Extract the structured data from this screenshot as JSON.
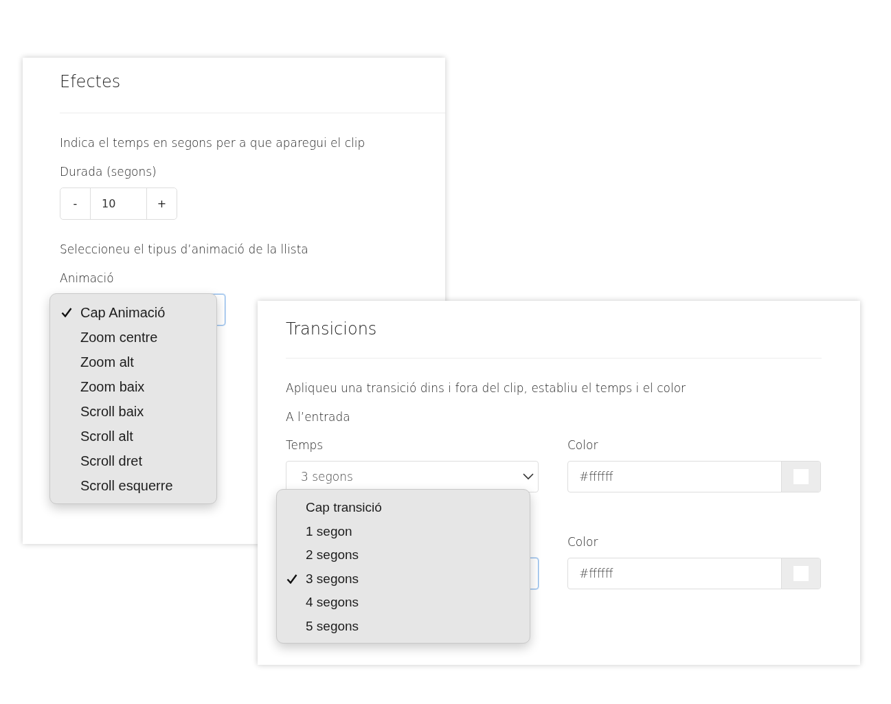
{
  "effects_panel": {
    "title": "Efectes",
    "duration_hint": "Indica el temps en segons per a que aparegui el clip",
    "duration_label": "Durada (segons)",
    "stepper": {
      "decrement": "-",
      "value": "10",
      "increment": "+"
    },
    "animation_hint": "Seleccioneu el tipus d’animació de la llista",
    "animation_label": "Animació",
    "animation_menu": [
      {
        "label": "Cap Animació",
        "selected": true
      },
      {
        "label": "Zoom centre",
        "selected": false
      },
      {
        "label": "Zoom alt",
        "selected": false
      },
      {
        "label": "Zoom baix",
        "selected": false
      },
      {
        "label": "Scroll baix",
        "selected": false
      },
      {
        "label": "Scroll alt",
        "selected": false
      },
      {
        "label": "Scroll dret",
        "selected": false
      },
      {
        "label": "Scroll esquerre",
        "selected": false
      }
    ]
  },
  "transitions_panel": {
    "title": "Transicions",
    "hint": "Apliqueu una transició dins i fora del clip, establiu el temps i el color",
    "entry_label": "A l’entrada",
    "entry": {
      "time_label": "Temps",
      "time_value": "3 segons",
      "color_label": "Color",
      "color_value": "#ffffff"
    },
    "exit": {
      "color_label": "Color",
      "color_value": "#ffffff"
    },
    "time_menu": [
      {
        "label": "Cap transició",
        "selected": false
      },
      {
        "label": "1 segon",
        "selected": false
      },
      {
        "label": "2 segons",
        "selected": false
      },
      {
        "label": "3 segons",
        "selected": true
      },
      {
        "label": "4 segons",
        "selected": false
      },
      {
        "label": "5 segons",
        "selected": false
      }
    ]
  }
}
